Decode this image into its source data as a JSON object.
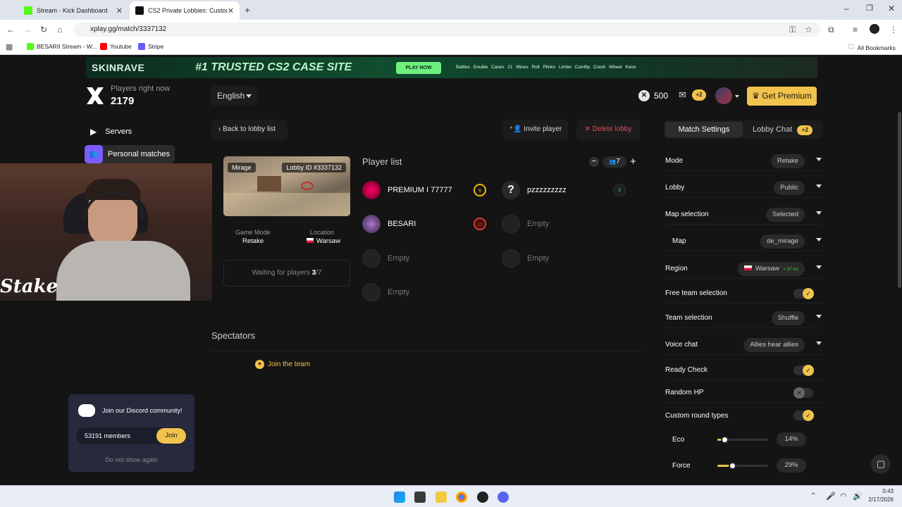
{
  "browser": {
    "tabs": [
      {
        "title": "Stream - Kick Dashboard",
        "favicon_color": "#53fc18",
        "active": false
      },
      {
        "title": "CS2 Private Lobbies: Custom M",
        "favicon_color": "#111111",
        "active": true
      }
    ],
    "url": "xplay.gg/match/3337132",
    "bookmarks": [
      {
        "label": "BESARII Stream - W...",
        "color": "#53fc18"
      },
      {
        "label": "Youtube",
        "color": "#ff0000"
      },
      {
        "label": "Stripe",
        "color": "#635bff"
      }
    ],
    "all_bookmarks": "All Bookmarks"
  },
  "banner": {
    "brand": "SKINRAVE",
    "headline": "#1 TRUSTED CS2 CASE SITE",
    "cta": "PLAY NOW",
    "games": "Battles Double Cases 21 Mines Roll Plinko Limbo Coinflip Crash Wheel Keno"
  },
  "header": {
    "players_label": "Players right now",
    "players_count": "2179",
    "language": "English",
    "coins": "500",
    "mail_badge": "+2",
    "premium_label": "Get Premium"
  },
  "sidebar": {
    "items": [
      {
        "label": "Servers"
      },
      {
        "label": "Personal matches"
      }
    ]
  },
  "lobby": {
    "back_label": "Back to lobby list",
    "invite_label": "Invite player",
    "delete_label": "Delete lobby",
    "map_name": "Mirage",
    "lobby_id": "Lobby ID #3337132",
    "game_mode_label": "Game Mode",
    "game_mode_value": "Retake",
    "location_label": "Location",
    "location_value": "Warsaw",
    "waiting_text": "Waiting for players",
    "waiting_current": "3",
    "waiting_total": "/7",
    "player_list_title": "Player list",
    "max_players": "7",
    "players": [
      {
        "name": "PREMIUM I 77777",
        "level": "6",
        "level_color": "#f5b800",
        "avatar_color": "#c0306a",
        "empty": false
      },
      {
        "name": "pzzzzzzzzz",
        "level": "3",
        "level_color": "#3ecf4a",
        "avatar_color": "#2a2a2a",
        "empty": false
      },
      {
        "name": "BESARI",
        "level": "10",
        "level_color": "#e53935",
        "avatar_color": "#6a4a7a",
        "empty": false
      },
      {
        "name": "Empty",
        "empty": true
      },
      {
        "name": "Empty",
        "empty": true
      },
      {
        "name": "Empty",
        "empty": true
      },
      {
        "name": "Empty",
        "empty": true
      }
    ],
    "spectators_title": "Spectators",
    "join_team_label": "Join the team"
  },
  "discord": {
    "title": "Join our Discord community!",
    "members": "53191 members",
    "join_label": "Join",
    "dismiss_label": "Do not show again"
  },
  "webcam": {
    "watermark": "Stake"
  },
  "settings": {
    "tab_match": "Match Settings",
    "tab_chat": "Lobby Chat",
    "chat_badge": "+2",
    "rows": [
      {
        "label": "Mode",
        "value": "Retake",
        "kind": "select"
      },
      {
        "label": "Lobby",
        "value": "Public",
        "kind": "select"
      },
      {
        "label": "Map selection",
        "value": "Selected",
        "kind": "select"
      },
      {
        "label": "Map",
        "value": "de_mirage",
        "kind": "select",
        "indent": true
      },
      {
        "label": "Region",
        "value": "Warsaw",
        "ping": "< 37 ms",
        "kind": "select"
      },
      {
        "label": "Free team selection",
        "kind": "toggle",
        "on": true
      },
      {
        "label": "Team selection",
        "value": "Shuffle",
        "kind": "select"
      },
      {
        "label": "Voice chat",
        "value": "Allies hear allies",
        "kind": "select"
      },
      {
        "label": "Ready Check",
        "kind": "toggle",
        "on": true
      },
      {
        "label": "Random HP",
        "kind": "toggle",
        "on": false
      },
      {
        "label": "Custom round types",
        "kind": "toggle",
        "on": true
      }
    ],
    "sliders": [
      {
        "label": "Eco",
        "value": "14%",
        "fraction": 0.14
      },
      {
        "label": "Force",
        "value": "29%",
        "fraction": 0.29
      }
    ]
  },
  "taskbar": {
    "time": "0:43",
    "date": "2/17/2026"
  }
}
